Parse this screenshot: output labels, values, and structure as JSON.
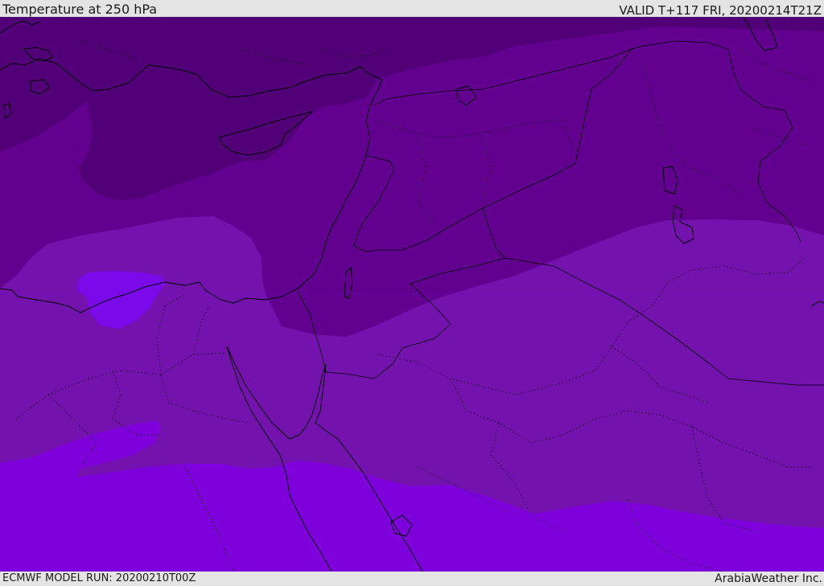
{
  "header": {
    "title": "Temperature at 250 hPa",
    "valid": "VALID T+117 FRI, 20200214T21Z"
  },
  "footer": {
    "model_run": "ECMWF MODEL RUN: 20200210T00Z",
    "credit": "ArabiaWeather Inc."
  },
  "map": {
    "colors": {
      "darkest": "#520078",
      "dark": "#62008f",
      "mid": "#7412ad",
      "bright": "#7e00db",
      "accent": "#7a0aea",
      "border": "#000000"
    }
  }
}
